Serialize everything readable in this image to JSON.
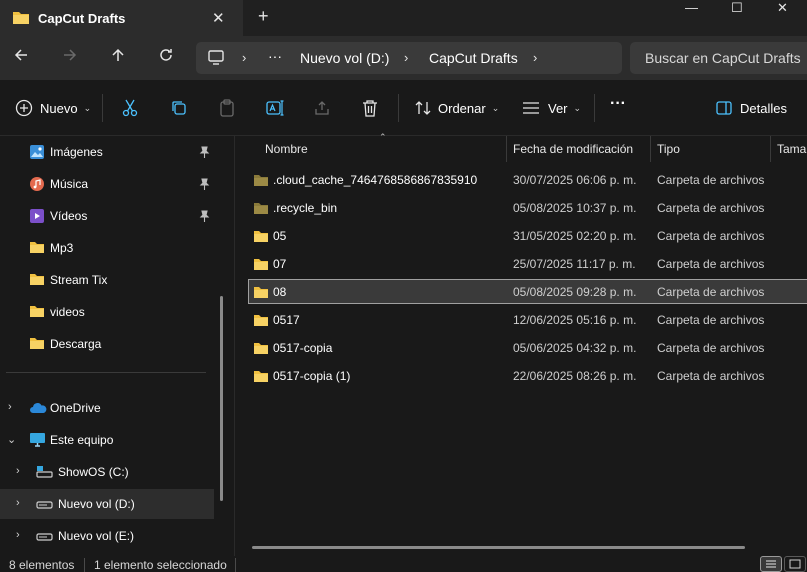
{
  "window": {
    "tab_title": "CapCut Drafts",
    "new_tab": "+",
    "close_tab": "✕",
    "minimize": "—",
    "maximize": "☐",
    "close": "✕"
  },
  "address_bar": {
    "more": "···",
    "crumbs": [
      "Nuevo vol (D:)",
      "CapCut Drafts"
    ],
    "search_placeholder": "Buscar en CapCut Drafts"
  },
  "command_bar": {
    "new_label": "Nuevo",
    "sort_label": "Ordenar",
    "view_label": "Ver",
    "more": "···",
    "details_label": "Detalles"
  },
  "sidebar": {
    "quick_access": [
      {
        "label": "Imágenes",
        "icon": "pictures-icon",
        "pinned": true
      },
      {
        "label": "Música",
        "icon": "music-icon",
        "pinned": true
      },
      {
        "label": "Vídeos",
        "icon": "videos-icon",
        "pinned": true
      },
      {
        "label": "Mp3",
        "icon": "folder-icon",
        "pinned": false
      },
      {
        "label": "Stream Tix",
        "icon": "folder-icon",
        "pinned": false
      },
      {
        "label": "videos",
        "icon": "folder-icon",
        "pinned": false
      },
      {
        "label": "Descarga",
        "icon": "folder-icon",
        "pinned": false
      }
    ],
    "tree": [
      {
        "label": "OneDrive",
        "icon": "onedrive-icon",
        "expanded": false
      },
      {
        "label": "Este equipo",
        "icon": "this-pc-icon",
        "expanded": true
      },
      {
        "label": "ShowOS (C:)",
        "icon": "system-drive-icon",
        "expanded": false
      },
      {
        "label": "Nuevo vol (D:)",
        "icon": "drive-icon",
        "expanded": false,
        "selected": true
      },
      {
        "label": "Nuevo vol (E:)",
        "icon": "drive-icon",
        "expanded": false
      }
    ]
  },
  "file_list": {
    "columns": [
      "Nombre",
      "Fecha de modificación",
      "Tipo",
      "Tamaño"
    ],
    "rows": [
      {
        "name": ".cloud_cache_7464768586867835910",
        "date": "30/07/2025 06:06 p. m.",
        "type": "Carpeta de archivos",
        "dim": true
      },
      {
        "name": ".recycle_bin",
        "date": "05/08/2025 10:37 p. m.",
        "type": "Carpeta de archivos",
        "dim": true
      },
      {
        "name": "05",
        "date": "31/05/2025 02:20 p. m.",
        "type": "Carpeta de archivos",
        "dim": false
      },
      {
        "name": "07",
        "date": "25/07/2025 11:17 p. m.",
        "type": "Carpeta de archivos",
        "dim": false
      },
      {
        "name": "08",
        "date": "05/08/2025 09:28 p. m.",
        "type": "Carpeta de archivos",
        "dim": false,
        "selected": true
      },
      {
        "name": "0517",
        "date": "12/06/2025 05:16 p. m.",
        "type": "Carpeta de archivos",
        "dim": false
      },
      {
        "name": "0517-copia",
        "date": "05/06/2025 04:32 p. m.",
        "type": "Carpeta de archivos",
        "dim": false
      },
      {
        "name": "0517-copia (1)",
        "date": "22/06/2025 08:26 p. m.",
        "type": "Carpeta de archivos",
        "dim": false
      }
    ]
  },
  "status_bar": {
    "item_count": "8 elementos",
    "selection": "1 elemento seleccionado"
  },
  "colors": {
    "folder": "#f0c040",
    "folder_dim": "#8a7a3a",
    "accent": "#4cc2ff"
  }
}
